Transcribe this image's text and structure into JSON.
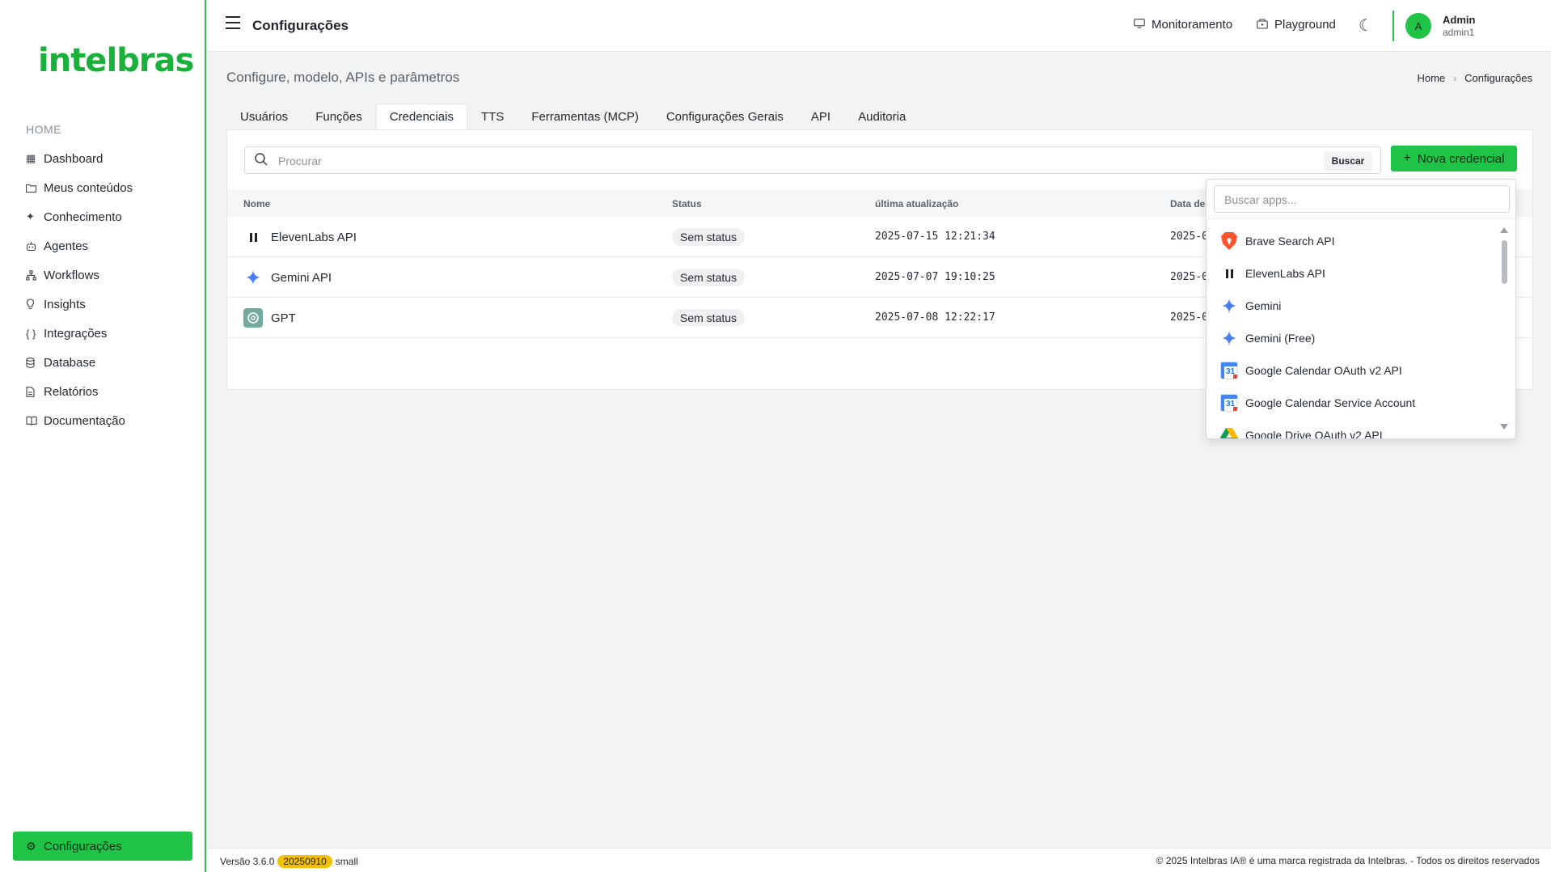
{
  "sidebar": {
    "logo": "intelbras",
    "section": "HOME",
    "items": [
      {
        "label": "Dashboard",
        "icon": "grid-icon"
      },
      {
        "label": "Meus conteúdos",
        "icon": "folder-icon"
      },
      {
        "label": "Conhecimento",
        "icon": "sparkle-icon"
      },
      {
        "label": "Agentes",
        "icon": "robot-icon"
      },
      {
        "label": "Workflows",
        "icon": "workflow-icon"
      },
      {
        "label": "Insights",
        "icon": "lightbulb-icon"
      },
      {
        "label": "Integrações",
        "icon": "braces-icon"
      },
      {
        "label": "Database",
        "icon": "database-icon"
      },
      {
        "label": "Relatórios",
        "icon": "report-icon"
      },
      {
        "label": "Documentação",
        "icon": "book-icon"
      }
    ],
    "bottom": {
      "label": "Configurações",
      "icon": "gear-icon"
    }
  },
  "header": {
    "title": "Configurações",
    "monitoramento": "Monitoramento",
    "playground": "Playground",
    "avatar_initial": "A",
    "user_name": "Admin",
    "user_login": "admin1"
  },
  "page": {
    "subtitle": "Configure, modelo, APIs e parâmetros",
    "breadcrumb": [
      "Home",
      "Configurações"
    ]
  },
  "tabs": [
    {
      "label": "Usuários",
      "active": false
    },
    {
      "label": "Funções",
      "active": false
    },
    {
      "label": "Credenciais",
      "active": true
    },
    {
      "label": "TTS",
      "active": false
    },
    {
      "label": "Ferramentas (MCP)",
      "active": false
    },
    {
      "label": "Configurações Gerais",
      "active": false
    },
    {
      "label": "API",
      "active": false
    },
    {
      "label": "Auditoria",
      "active": false
    }
  ],
  "credentials": {
    "search_placeholder": "Procurar",
    "search_button": "Buscar",
    "new_button": "Nova credencial",
    "columns": {
      "name": "Nome",
      "status": "Status",
      "updated": "última atualização",
      "created": "Data de"
    },
    "rows": [
      {
        "name": "ElevenLabs API",
        "icon": "elevenlabs-icon",
        "status": "Sem status",
        "updated": "2025-07-15 12:21:34",
        "created": "2025-0"
      },
      {
        "name": "Gemini API",
        "icon": "gemini-icon",
        "status": "Sem status",
        "updated": "2025-07-07 19:10:25",
        "created": "2025-0"
      },
      {
        "name": "GPT",
        "icon": "openai-icon",
        "status": "Sem status",
        "updated": "2025-07-08 12:22:17",
        "created": "2025-0"
      }
    ]
  },
  "dropdown": {
    "search_placeholder": "Buscar  apps...",
    "items": [
      {
        "label": "Brave Search API",
        "icon": "brave-icon"
      },
      {
        "label": "ElevenLabs API",
        "icon": "elevenlabs-icon"
      },
      {
        "label": "Gemini",
        "icon": "gemini-icon"
      },
      {
        "label": "Gemini (Free)",
        "icon": "gemini-icon"
      },
      {
        "label": "Google Calendar OAuth v2 API",
        "icon": "google-calendar-icon"
      },
      {
        "label": "Google Calendar Service Account",
        "icon": "google-calendar-icon"
      },
      {
        "label": "Google Drive OAuth v2 API",
        "icon": "google-drive-icon"
      }
    ]
  },
  "footer": {
    "version": "Versão 3.6.0",
    "build": "20250910",
    "size": "small",
    "copyright": "© 2025 Intelbras IA® é uma marca registrada da Intelbras. - Todos os direitos reservados"
  },
  "colors": {
    "accent": "#1fc446",
    "brand": "#19b13a",
    "build_badge": "#f5c000"
  }
}
